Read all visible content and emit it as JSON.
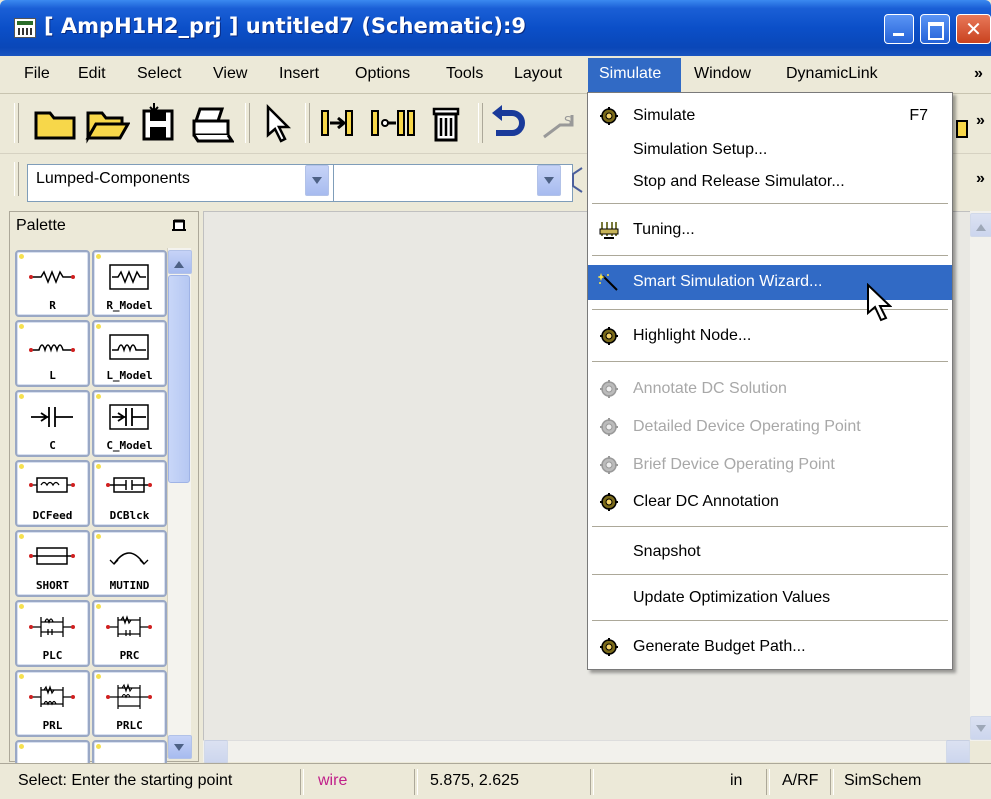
{
  "window": {
    "title": "[ AmpH1H2_prj ] untitled7 (Schematic):9",
    "close_glyph": "✕"
  },
  "menubar": {
    "items": [
      "File",
      "Edit",
      "Select",
      "View",
      "Insert",
      "Options",
      "Tools",
      "Layout",
      "Simulate",
      "Window",
      "DynamicLink"
    ],
    "overflow": "»",
    "active": "Simulate"
  },
  "toolbar": {
    "overflow": "»",
    "library_combo_value": "Lumped-Components",
    "second_combo_value": ""
  },
  "palette": {
    "title": "Palette",
    "items": [
      "R",
      "R_Model",
      "L",
      "L_Model",
      "C",
      "C_Model",
      "DCFeed",
      "DCBlck",
      "SHORT",
      "MUTIND",
      "PLC",
      "PRC",
      "PRL",
      "PRLC"
    ]
  },
  "simulate_menu": {
    "items": [
      {
        "label": "Simulate",
        "shortcut": "F7",
        "icon": "gear-icon",
        "disabled": false
      },
      {
        "label": "Simulation Setup...",
        "icon": "",
        "disabled": false
      },
      {
        "label": "Stop and Release Simulator...",
        "icon": "",
        "disabled": false
      },
      {
        "label": "Tuning...",
        "icon": "tuning-knob-icon",
        "disabled": false
      },
      {
        "label": "Smart Simulation Wizard...",
        "icon": "wizard-wand-icon",
        "disabled": false,
        "highlighted": true
      },
      {
        "label": "Highlight Node...",
        "icon": "gear-icon",
        "disabled": false
      },
      {
        "label": "Annotate DC Solution",
        "icon": "gear-icon",
        "disabled": true
      },
      {
        "label": "Detailed Device Operating Point",
        "icon": "gear-icon",
        "disabled": true
      },
      {
        "label": "Brief Device Operating Point",
        "icon": "gear-icon",
        "disabled": true
      },
      {
        "label": "Clear DC Annotation",
        "icon": "gear-icon",
        "disabled": false
      },
      {
        "label": "Snapshot",
        "icon": "",
        "disabled": false
      },
      {
        "label": "Update Optimization Values",
        "icon": "",
        "disabled": false
      },
      {
        "label": "Generate Budget Path...",
        "icon": "gear-icon",
        "disabled": false
      }
    ]
  },
  "statusbar": {
    "message": "Select: Enter the starting point",
    "mode": "wire",
    "coordinates": "5.875, 2.625",
    "units": "in",
    "domain": "A/RF",
    "simulator": "SimSchem"
  },
  "colors": {
    "highlight": "#316ac5",
    "status_mode": "#c0208a",
    "disabled_text": "#a8a8a8"
  }
}
